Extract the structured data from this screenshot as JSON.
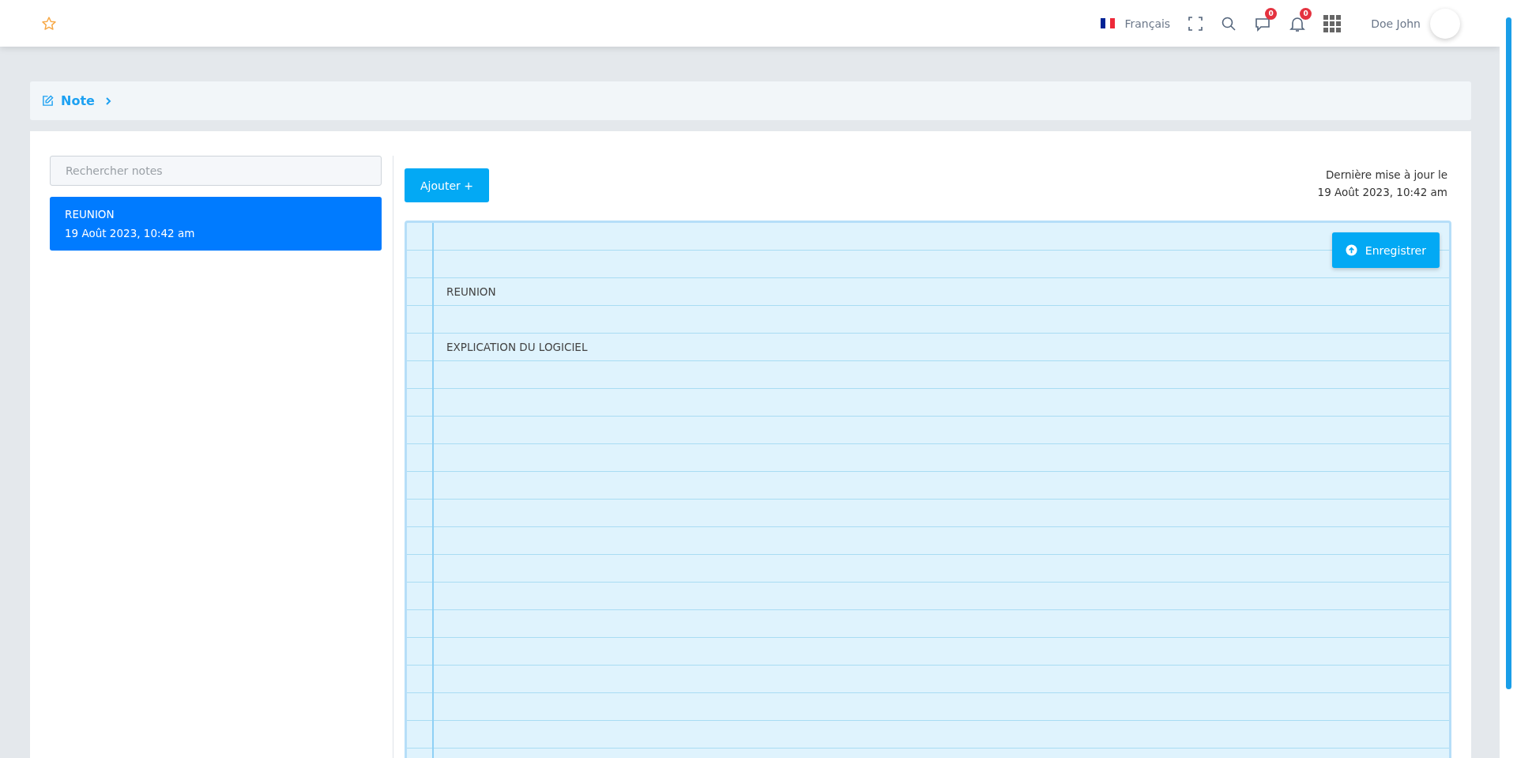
{
  "header": {
    "language": "Français",
    "messages_count": "0",
    "notifications_count": "0",
    "user_name": "Doe John"
  },
  "breadcrumb": {
    "title": "Note"
  },
  "search": {
    "placeholder": "Rechercher notes"
  },
  "notes": [
    {
      "title": "REUNION",
      "date": "19 Août 2023, 10:42 am",
      "selected": true
    }
  ],
  "editor": {
    "add_button": "Ajouter +",
    "updated_label": "Dernière mise à jour le",
    "updated_date": "19 Août 2023, 10:42 am",
    "save_button": "Enregistrer",
    "lines": [
      "REUNION",
      "EXPLICATION DU LOGICIEL"
    ]
  }
}
